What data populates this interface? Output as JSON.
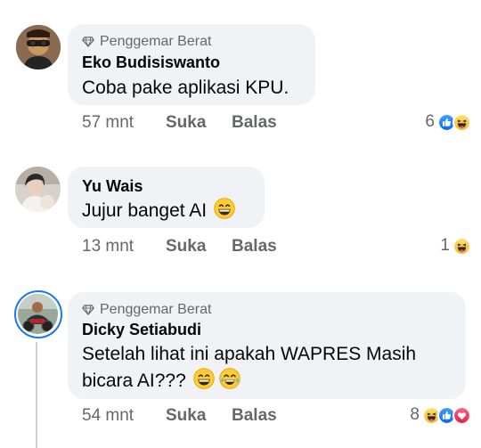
{
  "comments": [
    {
      "badge": "Penggemar Berat",
      "name": "Eko Budisiswanto",
      "text": "Coba pake aplikasi KPU.",
      "time": "57 mnt",
      "like_label": "Suka",
      "reply_label": "Balas",
      "reaction_count": "6",
      "reactions": [
        "like-reaction-icon",
        "haha-reaction-icon"
      ]
    },
    {
      "name": "Yu Wais",
      "text": "Jujur banget AI",
      "text_emoji": "grinning-emoji",
      "time": "13 mnt",
      "like_label": "Suka",
      "reply_label": "Balas",
      "reaction_count": "1",
      "reactions": [
        "haha-reaction-icon"
      ]
    },
    {
      "badge": "Penggemar Berat",
      "name": "Dicky Setiabudi",
      "text_line1": "Setelah lihat ini apakah WAPRES Masih",
      "text_line2": "bicara AI???",
      "text_emoji": [
        "grinning-emoji",
        "joy-emoji"
      ],
      "time": "54 mnt",
      "like_label": "Suka",
      "reply_label": "Balas",
      "reaction_count": "8",
      "reactions": [
        "haha-reaction-icon",
        "like-reaction-icon",
        "love-reaction-icon"
      ]
    }
  ],
  "colors": {
    "bubble": "#f0f2f5",
    "like_blue": "#1877f2",
    "love_red": "#f33e58",
    "haha_yellow": "#f7b125",
    "muted_text": "#65676b",
    "avatar_ring": "#1877f2"
  }
}
